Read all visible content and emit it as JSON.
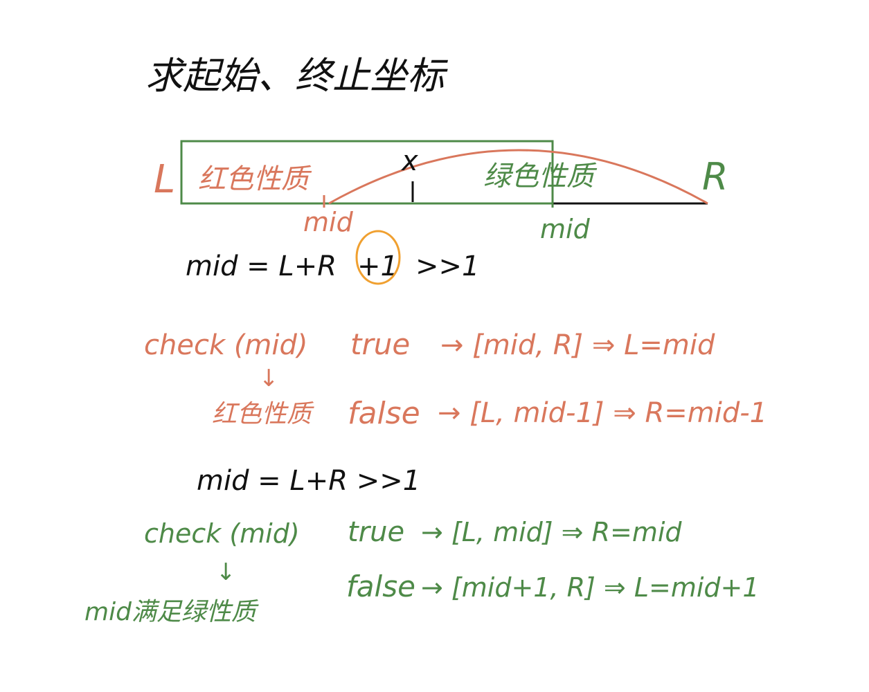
{
  "title": "求起始、终止坐标",
  "colors": {
    "black": "#111111",
    "red": "#d9775c",
    "green": "#4e8a48",
    "orange": "#f0a030"
  },
  "diagram": {
    "left_label": "L",
    "right_label": "R",
    "red_region_label": "红色性质",
    "green_region_label": "绿色性质",
    "x_label": "x",
    "red_mid_label": "mid",
    "green_mid_label": "mid"
  },
  "case1": {
    "formula_prefix": "mid = L+R",
    "formula_highlight": "+1",
    "formula_suffix": ">>1",
    "check": "check (mid)",
    "arrow": "↓",
    "note": "红色性质",
    "true_text": "true",
    "true_result": "→ [mid, R] ⇒ L=mid",
    "false_text": "false",
    "false_result": "→ [L, mid-1] ⇒ R=mid-1"
  },
  "case2": {
    "formula": "mid = L+R >>1",
    "check": "check (mid)",
    "arrow": "↓",
    "note": "mid满足绿性质",
    "true_text": "true",
    "true_result": "→ [L, mid] ⇒ R=mid",
    "false_text": "false",
    "false_result": "→ [mid+1, R] ⇒ L=mid+1"
  }
}
